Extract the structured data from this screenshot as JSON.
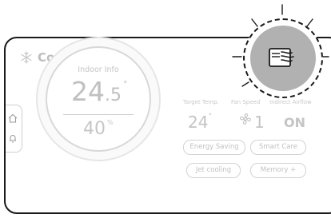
{
  "mode": {
    "label": "Cooling",
    "icon": "snowflake-icon"
  },
  "indoor": {
    "label": "Indoor Info",
    "temp_int": "24",
    "temp_dec": ".5",
    "temp_unit": "°",
    "humidity": "40",
    "humidity_unit": "%"
  },
  "stats": {
    "target_temp_label": "Target Temp.",
    "target_temp_value": "24",
    "target_temp_unit": "°",
    "fan_speed_label": "Fan Speed",
    "fan_speed_value": "1",
    "indirect_airflow_label": "Indirect Airflow",
    "indirect_airflow_value": "ON"
  },
  "options": [
    "Energy Saving",
    "Smart Care",
    "Jet cooling",
    "Memory +"
  ],
  "colors": {
    "highlight_fill": "#b1b1b1",
    "outline": "#1a1a1a",
    "muted_text": "#c4c4c4"
  }
}
